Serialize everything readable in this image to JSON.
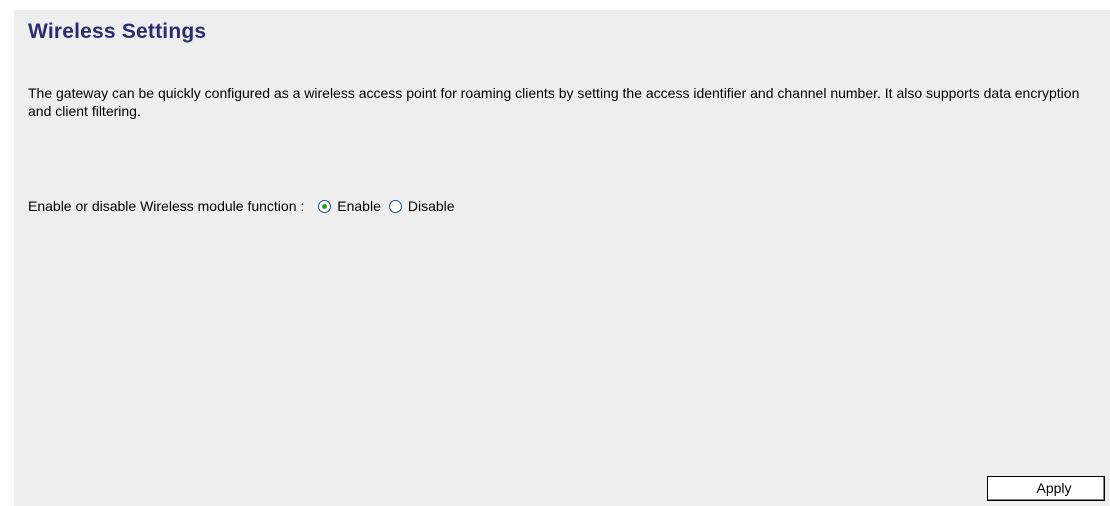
{
  "page": {
    "title": "Wireless Settings",
    "description": "The gateway can be quickly configured as a wireless access point for roaming clients by setting the access identifier and channel number. It also supports data encryption and client filtering."
  },
  "wireless_module": {
    "label": "Enable or disable Wireless module function :",
    "options": [
      {
        "label": "Enable",
        "checked": true
      },
      {
        "label": "Disable",
        "checked": false
      }
    ],
    "selected": "Enable"
  },
  "actions": {
    "apply_label": "Apply"
  },
  "colors": {
    "title": "#2b2d6e",
    "background": "#eeeeee",
    "radio_dot": "#21a121"
  }
}
